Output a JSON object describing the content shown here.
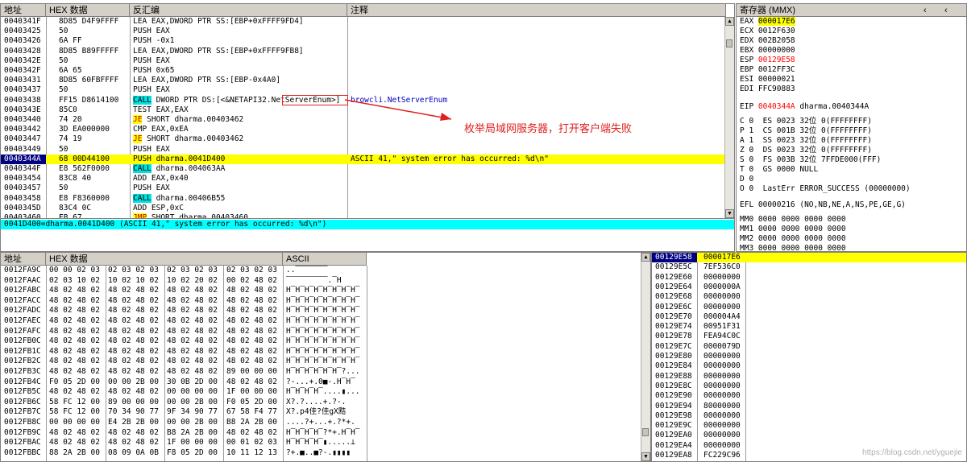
{
  "disasm": {
    "headers": {
      "addr": "地址",
      "hex": "HEX 数据",
      "disasm": "反汇编",
      "comment": "注释"
    },
    "rows": [
      {
        "addr": "0040341F",
        "hex": "8D85 D4F9FFFF",
        "asm": "LEA EAX,DWORD PTR SS:[EBP+0xFFFF9FD4]",
        "comment": ""
      },
      {
        "addr": "00403425",
        "hex": "50",
        "asm": "PUSH EAX",
        "comment": ""
      },
      {
        "addr": "00403426",
        "hex": "6A FF",
        "asm": "PUSH -0x1",
        "comment": ""
      },
      {
        "addr": "00403428",
        "hex": "8D85 B89FFFFF",
        "asm": "LEA EAX,DWORD PTR SS:[EBP+0xFFFF9FB8]",
        "comment": ""
      },
      {
        "addr": "0040342E",
        "hex": "50",
        "asm": "PUSH EAX",
        "comment": ""
      },
      {
        "addr": "0040342F",
        "hex": "6A 65",
        "asm": "PUSH 0x65",
        "comment": ""
      },
      {
        "addr": "00403431",
        "hex": "8D85 60FBFFFF",
        "asm": "LEA EAX,DWORD PTR SS:[EBP-0x4A0]",
        "comment": ""
      },
      {
        "addr": "00403437",
        "hex": "50",
        "asm": "PUSH EAX",
        "comment": ""
      },
      {
        "addr": "00403438",
        "hex": "FF15 D8614100",
        "asm": "CALL DWORD PTR DS:[<&NETAPI32.NetServerEnum>]",
        "comment": "browcli.NetServerEnum"
      },
      {
        "addr": "0040343E",
        "hex": "85C0",
        "asm": "TEST EAX,EAX",
        "comment": ""
      },
      {
        "addr": "00403440",
        "hex": "74 20",
        "asm": "JE SHORT dharma.00403462",
        "comment": ""
      },
      {
        "addr": "00403442",
        "hex": "3D EA000000",
        "asm": "CMP EAX,0xEA",
        "comment": ""
      },
      {
        "addr": "00403447",
        "hex": "74 19",
        "asm": "JE SHORT dharma.00403462",
        "comment": ""
      },
      {
        "addr": "00403449",
        "hex": "50",
        "asm": "PUSH EAX",
        "comment": ""
      },
      {
        "addr": "0040344A",
        "hex": "68 00D44100",
        "asm": "PUSH dharma.0041D400",
        "comment": "ASCII 41,\" system error has occurred: %d\\n\""
      },
      {
        "addr": "0040344F",
        "hex": "E8 562F0000",
        "asm": "CALL dharma.004063AA",
        "comment": ""
      },
      {
        "addr": "00403454",
        "hex": "83C8 40",
        "asm": "ADD EAX,0x40",
        "comment": ""
      },
      {
        "addr": "00403457",
        "hex": "50",
        "asm": "PUSH EAX",
        "comment": ""
      },
      {
        "addr": "00403458",
        "hex": "E8 F8360000",
        "asm": "CALL dharma.00406B55",
        "comment": ""
      },
      {
        "addr": "0040345D",
        "hex": "83C4 0C",
        "asm": "ADD ESP,0xC",
        "comment": ""
      },
      {
        "addr": "00403460",
        "hex": "EB 67",
        "asm": "JMP SHORT dharma.00403460",
        "comment": ""
      }
    ],
    "info_line": "0041D400=dharma.0041D400 (ASCII 41,\" system error has occurred: %d\\n\")",
    "annotation": "枚举局域网服务器，打开客户端失败"
  },
  "registers": {
    "title": "寄存器 (MMX)",
    "gp": [
      {
        "name": "EAX",
        "value": "000017E6"
      },
      {
        "name": "ECX",
        "value": "0012F630"
      },
      {
        "name": "EDX",
        "value": "002B2058"
      },
      {
        "name": "EBX",
        "value": "00000000"
      },
      {
        "name": "ESP",
        "value": "00129E58"
      },
      {
        "name": "EBP",
        "value": "0012FF3C"
      },
      {
        "name": "ESI",
        "value": "00000021"
      },
      {
        "name": "EDI",
        "value": "FFC90883"
      }
    ],
    "eip": "EIP 0040344A dharma.0040344A",
    "flags": [
      "C 0  ES 0023 32位 0(FFFFFFFF)",
      "P 1  CS 001B 32位 0(FFFFFFFF)",
      "A 1  SS 0023 32位 0(FFFFFFFF)",
      "Z 0  DS 0023 32位 0(FFFFFFFF)",
      "S 0  FS 003B 32位 7FFDE000(FFF)",
      "T 0  GS 0000 NULL",
      "D 0",
      "O 0  LastErr ERROR_SUCCESS (00000000)"
    ],
    "efl": "EFL 00000216 (NO,NB,NE,A,NS,PE,GE,G)",
    "mmx": [
      "MM0 0000 0000 0000 0000",
      "MM1 0000 0000 0000 0000",
      "MM2 0000 0000 0000 0000",
      "MM3 0000 0000 0000 0000"
    ]
  },
  "dump": {
    "headers": {
      "addr": "地址",
      "hex": "HEX 数据",
      "ascii": "ASCII"
    },
    "rows": [
      {
        "addr": "0012FA9C",
        "hex": "00 00 02 03|02 03 02 03|02 03 02 03|02 03 02 03",
        "ascii": "..▔▔▔▔▔▔▔"
      },
      {
        "addr": "0012FAAC",
        "hex": "02 03 10 02|10 02 10 02|10 02 20 02|00 02 48 02",
        "ascii": "▔▔▔▔▔▔▔▔▔.▔H"
      },
      {
        "addr": "0012FABC",
        "hex": "48 02 48 02|48 02 48 02|48 02 48 02|48 02 48 02",
        "ascii": "H▔H▔H▔H▔H▔H▔H▔H▔"
      },
      {
        "addr": "0012FACC",
        "hex": "48 02 48 02|48 02 48 02|48 02 48 02|48 02 48 02",
        "ascii": "H▔H▔H▔H▔H▔H▔H▔H▔"
      },
      {
        "addr": "0012FADC",
        "hex": "48 02 48 02|48 02 48 02|48 02 48 02|48 02 48 02",
        "ascii": "H▔H▔H▔H▔H▔H▔H▔H▔"
      },
      {
        "addr": "0012FAEC",
        "hex": "48 02 48 02|48 02 48 02|48 02 48 02|48 02 48 02",
        "ascii": "H▔H▔H▔H▔H▔H▔H▔H▔"
      },
      {
        "addr": "0012FAFC",
        "hex": "48 02 48 02|48 02 48 02|48 02 48 02|48 02 48 02",
        "ascii": "H▔H▔H▔H▔H▔H▔H▔H▔"
      },
      {
        "addr": "0012FB0C",
        "hex": "48 02 48 02|48 02 48 02|48 02 48 02|48 02 48 02",
        "ascii": "H▔H▔H▔H▔H▔H▔H▔H▔"
      },
      {
        "addr": "0012FB1C",
        "hex": "48 02 48 02|48 02 48 02|48 02 48 02|48 02 48 02",
        "ascii": "H▔H▔H▔H▔H▔H▔H▔H▔"
      },
      {
        "addr": "0012FB2C",
        "hex": "48 02 48 02|48 02 48 02|48 02 48 02|48 02 48 02",
        "ascii": "H▔H▔H▔H▔H▔H▔H▔H▔"
      },
      {
        "addr": "0012FB3C",
        "hex": "48 02 48 02|48 02 48 02|48 02 48 02|89 00 00 00",
        "ascii": "H▔H▔H▔H▔H▔H▔?..."
      },
      {
        "addr": "0012FB4C",
        "hex": "F0 05 2D 00|00 00 2B 00|30 0B 2D 00|48 02 48 02",
        "ascii": "?-...+.0■-.H▔H▔"
      },
      {
        "addr": "0012FB5C",
        "hex": "48 02 48 02|48 02 48 02|00 00 00 00|1F 00 00 00",
        "ascii": "H▔H▔H▔H▔....▮..."
      },
      {
        "addr": "0012FB6C",
        "hex": "58 FC 12 00|89 00 00 00|00 00 2B 00|F0 05 2D 00",
        "ascii": "X?.?....+.?-."
      },
      {
        "addr": "0012FB7C",
        "hex": "58 FC 12 00|70 34 90 77|9F 34 90 77|67 58 F4 77",
        "ascii": "X?.p4佳?佳gX黠"
      },
      {
        "addr": "0012FB8C",
        "hex": "00 00 00 00|E4 2B 2B 00|00 00 2B 00|B8 2A 2B 00",
        "ascii": "....?+...+.?*+."
      },
      {
        "addr": "0012FB9C",
        "hex": "48 02 48 02|48 02 48 02|B8 2A 2B 00|48 02 48 02",
        "ascii": "H▔H▔H▔H▔?*+.H▔H▔"
      },
      {
        "addr": "0012FBAC",
        "hex": "48 02 48 02|48 02 48 02|1F 00 00 00|00 01 02 03",
        "ascii": "H▔H▔H▔H▔▮.....⊥"
      },
      {
        "addr": "0012FBBC",
        "hex": "88 2A 2B 00|08 09 0A 0B|F8 05 2D 00|10 11 12 13",
        "ascii": "?+.■..■?-.▮▮▮▮"
      }
    ]
  },
  "stack": {
    "rows": [
      {
        "addr": "00129E58",
        "value": "000017E6"
      },
      {
        "addr": "00129E5C",
        "value": "7EF536C0"
      },
      {
        "addr": "00129E60",
        "value": "00000000"
      },
      {
        "addr": "00129E64",
        "value": "0000000A"
      },
      {
        "addr": "00129E68",
        "value": "00000000"
      },
      {
        "addr": "00129E6C",
        "value": "00000000"
      },
      {
        "addr": "00129E70",
        "value": "000004A4"
      },
      {
        "addr": "00129E74",
        "value": "00951F31"
      },
      {
        "addr": "00129E78",
        "value": "FEA94C0C"
      },
      {
        "addr": "00129E7C",
        "value": "0000079D"
      },
      {
        "addr": "00129E80",
        "value": "00000000"
      },
      {
        "addr": "00129E84",
        "value": "00000000"
      },
      {
        "addr": "00129E88",
        "value": "00000000"
      },
      {
        "addr": "00129E8C",
        "value": "00000000"
      },
      {
        "addr": "00129E90",
        "value": "00000000"
      },
      {
        "addr": "00129E94",
        "value": "80000000"
      },
      {
        "addr": "00129E98",
        "value": "00000000"
      },
      {
        "addr": "00129E9C",
        "value": "00000000"
      },
      {
        "addr": "00129EA0",
        "value": "00000000"
      },
      {
        "addr": "00129EA4",
        "value": "00000000"
      },
      {
        "addr": "00129EA8",
        "value": "FC229C96"
      }
    ]
  },
  "watermark": "https://blog.csdn.net/yguejie"
}
